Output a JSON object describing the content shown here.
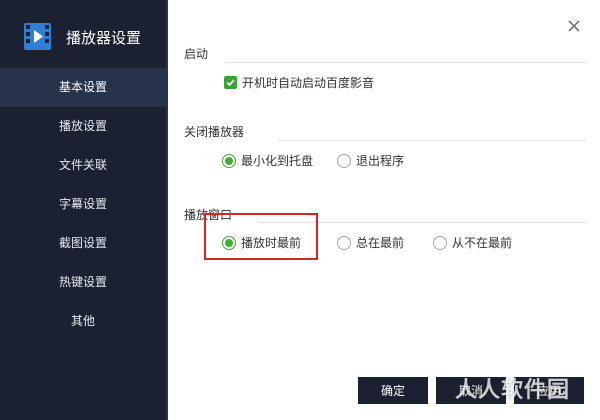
{
  "app": {
    "title": "播放器设置"
  },
  "sidebar": {
    "items": [
      {
        "label": "基本设置",
        "active": true
      },
      {
        "label": "播放设置"
      },
      {
        "label": "文件关联"
      },
      {
        "label": "字幕设置"
      },
      {
        "label": "截图设置"
      },
      {
        "label": "热键设置"
      },
      {
        "label": "其他"
      }
    ]
  },
  "sections": {
    "startup": {
      "title": "启动",
      "autostart": {
        "label": "开机时自动启动百度影音",
        "checked": true
      }
    },
    "close": {
      "title": "关闭播放器",
      "options": [
        {
          "label": "最小化到托盘",
          "selected": true
        },
        {
          "label": "退出程序",
          "selected": false
        }
      ]
    },
    "window": {
      "title": "播放窗口",
      "options": [
        {
          "label": "播放时最前",
          "selected": true
        },
        {
          "label": "总在最前",
          "selected": false
        },
        {
          "label": "从不在最前",
          "selected": false
        }
      ]
    }
  },
  "buttons": {
    "ok": "确定",
    "cancel": "取消",
    "apply": "应用"
  },
  "watermark": "人人软件园",
  "colors": {
    "sidebar_bg": "#1b2130",
    "sidebar_active": "#27334a",
    "check_green": "#3aa236",
    "highlight_red": "#d9252a"
  },
  "icons": {
    "close": "close-icon",
    "logo": "player-logo-icon"
  }
}
